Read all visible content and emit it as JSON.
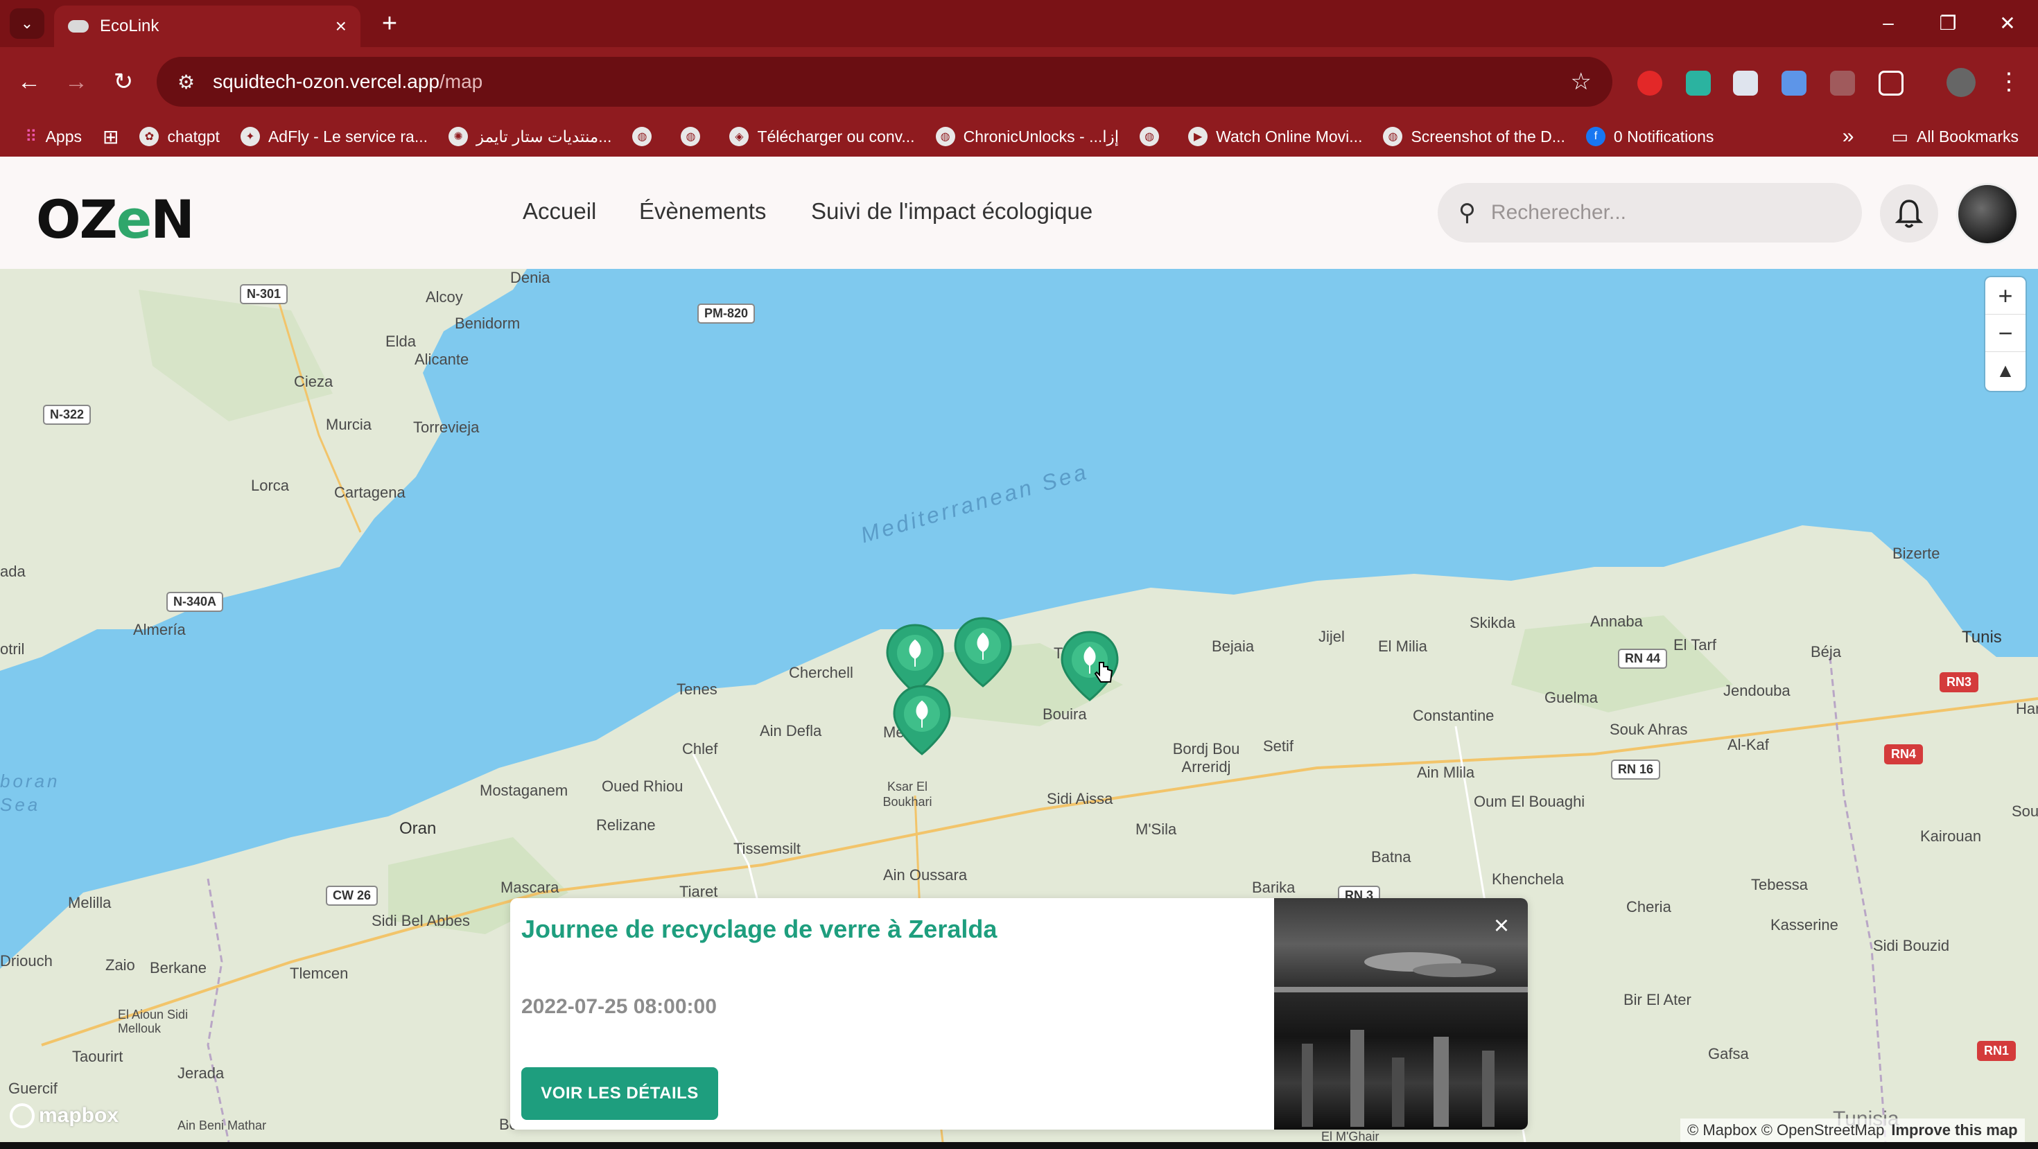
{
  "browser": {
    "tab_title": "EcoLink",
    "url_host": "squidtech-ozon.vercel.app",
    "url_path": "/map",
    "bookmarks": [
      {
        "label": "Apps"
      },
      {
        "label": "chatgpt"
      },
      {
        "label": "AdFly - Le service ra..."
      },
      {
        "label": "منتديات ستار تايمز..."
      },
      {
        "label": "Télécharger ou conv..."
      },
      {
        "label": "ChronicUnlocks - ...إزا"
      },
      {
        "label": "Watch Online Movi..."
      },
      {
        "label": "Screenshot of the D..."
      },
      {
        "label": "0 Notifications"
      }
    ],
    "all_bookmarks": "All Bookmarks"
  },
  "site": {
    "logo_text_a": "OZ",
    "logo_text_b": "e",
    "logo_text_c": "N",
    "nav": {
      "home": "Accueil",
      "events": "Évènements",
      "impact": "Suivi de l'impact écologique"
    },
    "search_placeholder": "Recherecher..."
  },
  "map": {
    "sea_label": "Mediterranean Sea",
    "sea_label_2": "boran\nSea",
    "places": [
      {
        "name": "Denia"
      },
      {
        "name": "Alcoy"
      },
      {
        "name": "Benidorm"
      },
      {
        "name": "Elda"
      },
      {
        "name": "Alicante"
      },
      {
        "name": "Cieza"
      },
      {
        "name": "Murcia"
      },
      {
        "name": "Torrevieja"
      },
      {
        "name": "Lorca"
      },
      {
        "name": "Cartagena"
      },
      {
        "name": "Almería"
      },
      {
        "name": "otril"
      },
      {
        "name": "ada"
      },
      {
        "name": "Tenes"
      },
      {
        "name": "Cherchell"
      },
      {
        "name": "Chlef"
      },
      {
        "name": "Ain Defla"
      },
      {
        "name": "Mostaganem"
      },
      {
        "name": "Oued Rhiou"
      },
      {
        "name": "Oran"
      },
      {
        "name": "Relizane"
      },
      {
        "name": "Tissemsilt"
      },
      {
        "name": "Mascara"
      },
      {
        "name": "Tiaret"
      },
      {
        "name": "Sidi Bel Abbes"
      },
      {
        "name": "Melilla"
      },
      {
        "name": "Driouch"
      },
      {
        "name": "Zaio"
      },
      {
        "name": "Berkane"
      },
      {
        "name": "Tlemcen"
      },
      {
        "name": "El Aioun Sidi Mellouk"
      },
      {
        "name": "Taourirt"
      },
      {
        "name": "Jerada"
      },
      {
        "name": "Guercif"
      },
      {
        "name": "Ain Beni Mathar"
      },
      {
        "name": "Ksar El Boukhari"
      },
      {
        "name": "Ain Oussara"
      },
      {
        "name": "Sidi Aissa"
      },
      {
        "name": "Bouira"
      },
      {
        "name": "Bejaia"
      },
      {
        "name": "Jijel"
      },
      {
        "name": "El Milia"
      },
      {
        "name": "Skikda"
      },
      {
        "name": "Annaba"
      },
      {
        "name": "El Tarf"
      },
      {
        "name": "Béja"
      },
      {
        "name": "Tunis"
      },
      {
        "name": "Bizerte"
      },
      {
        "name": "Jendouba"
      },
      {
        "name": "Hamma"
      },
      {
        "name": "Constantine"
      },
      {
        "name": "Guelma"
      },
      {
        "name": "Souk Ahras"
      },
      {
        "name": "Al-Kaf"
      },
      {
        "name": "Bordj Bou Arreridj"
      },
      {
        "name": "Setif"
      },
      {
        "name": "Ain Mlila"
      },
      {
        "name": "Oum El Bouaghi"
      },
      {
        "name": "M'Sila"
      },
      {
        "name": "Batna"
      },
      {
        "name": "Barika"
      },
      {
        "name": "Khenchela"
      },
      {
        "name": "Cheria"
      },
      {
        "name": "Tebessa"
      },
      {
        "name": "Kasserine"
      },
      {
        "name": "Kairouan"
      },
      {
        "name": "Sidi Bouzid"
      },
      {
        "name": "Bir El Ater"
      },
      {
        "name": "Gafsa"
      },
      {
        "name": "Tunisia"
      },
      {
        "name": "Sous"
      },
      {
        "name": "Mea"
      },
      {
        "name": "T"
      },
      {
        "name": "Bo"
      },
      {
        "name": "El M'Ghair"
      }
    ],
    "roads": [
      "N-301",
      "PM-820",
      "N-322",
      "N-340A",
      "CW 26",
      "RN 44",
      "RN3",
      "RN4",
      "RN 16",
      "RN 3",
      "RN1"
    ],
    "attribution_a": "© Mapbox",
    "attribution_b": "© OpenStreetMap",
    "attribution_c": "Improve this map",
    "mapbox_logo": "mapbox",
    "zoom_in": "+",
    "zoom_out": "−"
  },
  "popup": {
    "title": "Journee de recyclage de verre à Zeralda",
    "date": "2022-07-25 08:00:00",
    "button": "VOIR LES DÉTAILS",
    "close": "×"
  },
  "colors": {
    "chrome": "#8f1b1f",
    "brand_green": "#1e9e7e",
    "marker_green": "#2aa878",
    "sea": "#7fc9ee",
    "land": "#dfe7d3"
  }
}
